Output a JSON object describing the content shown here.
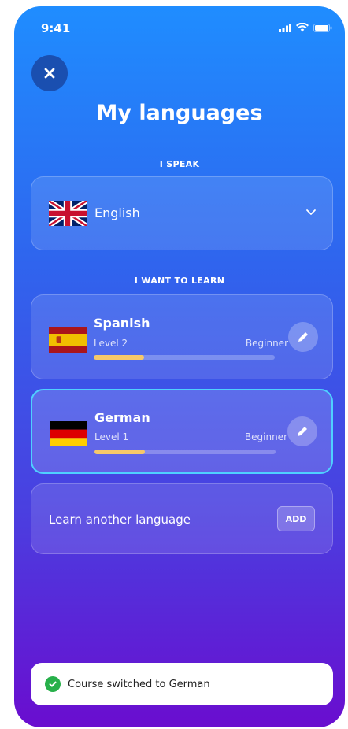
{
  "status_bar": {
    "time": "9:41"
  },
  "header": {
    "title": "My languages"
  },
  "speak": {
    "section_label": "I SPEAK",
    "language": "English"
  },
  "learn": {
    "section_label": "I WANT TO LEARN",
    "courses": [
      {
        "name": "Spanish",
        "level": "Level 2",
        "proficiency": "Beginner",
        "progress": 0.28
      },
      {
        "name": "German",
        "level": "Level 1",
        "proficiency": "Beginner",
        "progress": 0.28,
        "active": true
      }
    ]
  },
  "add_language": {
    "label": "Learn another language",
    "button": "ADD"
  },
  "toast": {
    "message": "Course switched to German"
  },
  "colors": {
    "gradient_top": "#1f8dff",
    "gradient_bottom": "#6a0dcf",
    "progress_fill": "#f6c86a",
    "active_border": "#4fd0ff",
    "success": "#27b04a"
  }
}
